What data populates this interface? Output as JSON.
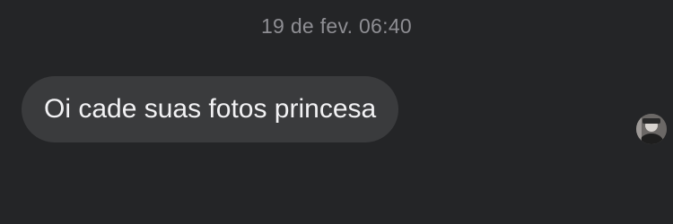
{
  "conversation": {
    "timestamp": "19 de fev. 06:40",
    "messages": [
      {
        "sender": "incoming",
        "text": "Oi cade suas fotos princesa"
      }
    ]
  },
  "icons": {
    "avatar": "user-avatar-photo"
  },
  "colors": {
    "background": "#242527",
    "bubble": "#3a3b3d",
    "message_text": "#f2f2f4",
    "timestamp_text": "#8e8e93"
  }
}
